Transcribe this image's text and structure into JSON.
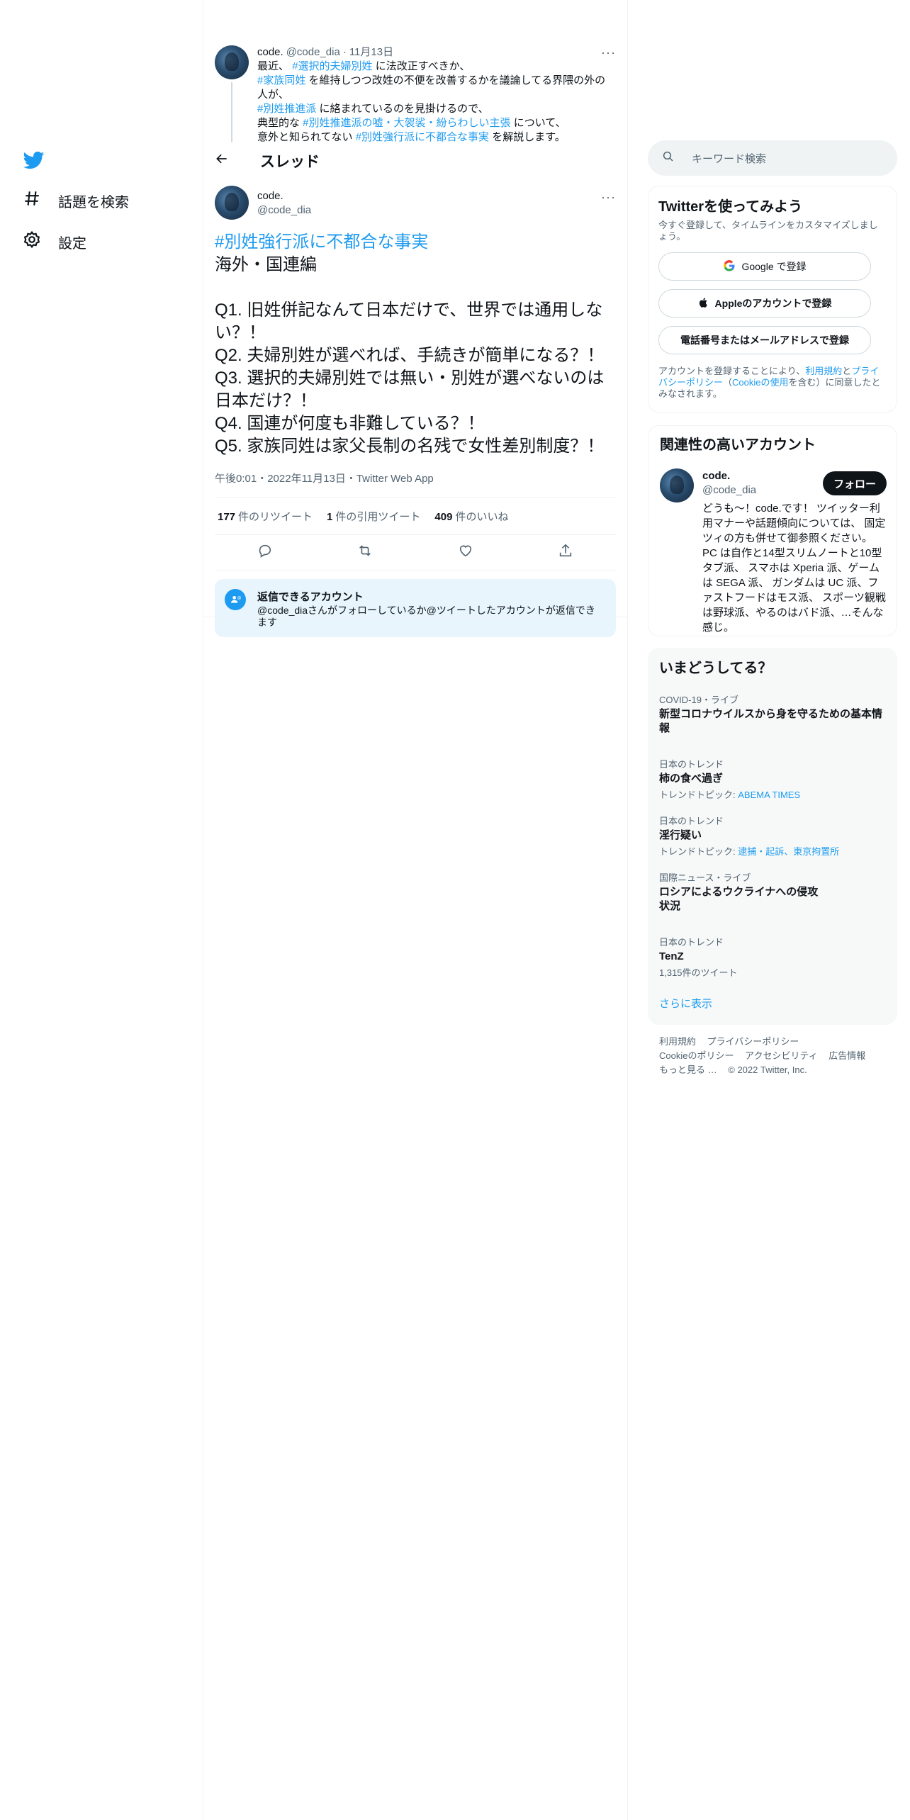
{
  "nav": {
    "items": [
      {
        "label": "話題を検索",
        "icon": "hashtag-icon"
      },
      {
        "label": "設定",
        "icon": "gear-icon"
      }
    ]
  },
  "parent_tweet": {
    "name": "code.",
    "handle": "@code_dia",
    "date": "11月13日",
    "line1_pre": "最近、",
    "line1_tag": "#選択的夫婦別姓",
    "line1_post": " に法改正すべきか、",
    "line2_tag": "#家族同姓",
    "line2_post": " を維持しつつ改姓の不便を改善するかを議論してる界隈の外の人が、",
    "line3_tag": "#別姓推進派",
    "line3_post": " に絡まれているのを見掛けるので、",
    "line4_pre": "典型的な ",
    "line4_tag": "#別姓推進派の嘘・大袈裟・紛らわしい主張",
    "line4_post": " について、",
    "line5_pre": "意外と知られてない ",
    "line5_tag": "#別姓強行派に不都合な事実",
    "line5_post": " を解説します。"
  },
  "thread_header": {
    "title": "スレッド"
  },
  "tweet": {
    "name": "code.",
    "handle": "@code_dia",
    "hashtag": "#別姓強行派に不都合な事実",
    "body": "海外・国連編\n\nQ1. 旧姓併記なんて日本だけで、世界では通用しない？！\nQ2. 夫婦別姓が選べれば、手続きが簡単になる？！\nQ3. 選択的夫婦別姓では無い・別姓が選べないのは日本だけ？！\nQ4. 国連が何度も非難している？！\nQ5. 家族同姓は家父長制の名残で女性差別制度？！",
    "meta": "午後0:01・2022年11月13日・Twitter Web App",
    "retweets_count": "177",
    "retweets_label": "件のリツイート",
    "quotes_count": "1",
    "quotes_label": "件の引用ツイート",
    "likes_count": "409",
    "likes_label": "件のいいね"
  },
  "reply_box": {
    "title": "返信できるアカウント",
    "text": "@code_diaさんがフォローしているか@ツイートしたアカウントが返信できます"
  },
  "search": {
    "placeholder": "キーワード検索"
  },
  "signup": {
    "title": "Twitterを使ってみよう",
    "subtitle": "今すぐ登録して、タイムラインをカスタマイズしましょう。",
    "google_label": "Google で登録",
    "apple_label": "Appleのアカウントで登録",
    "phone_label": "電話番号またはメールアドレスで登録",
    "legal_pre": "アカウントを登録することにより、",
    "legal_terms": "利用規約",
    "legal_and": "と",
    "legal_privacy": "プライバシーポリシー",
    "legal_mid": "（",
    "legal_cookie": "Cookieの使用",
    "legal_post": "を含む）に同意したとみなされます。"
  },
  "related": {
    "title": "関連性の高いアカウント",
    "name": "code.",
    "handle": "@code_dia",
    "follow_label": "フォロー",
    "bio": "どうも～！code.です！ ツイッター利用マナーや話題傾向については、 固定ツィの方も併せて御参照ください。　PC は自作と14型スリムノートと10型タブ派、 スマホは Xperia 派、ゲームは SEGA 派、 ガンダムは UC 派、ファストフードはモス派、 スポーツ観戦は野球派、やるのはバド派、…そんな感じ。"
  },
  "trends": {
    "title": "いまどうしてる？",
    "items": [
      {
        "context": "COVID-19・ライブ",
        "title": "新型コロナウイルスから身を守るための基本情報",
        "sub_label": "",
        "sub_link": ""
      },
      {
        "context": "日本のトレンド",
        "title": "柿の食べ過ぎ",
        "sub_label": "トレンドトピック: ",
        "sub_link": "ABEMA TIMES"
      },
      {
        "context": "日本のトレンド",
        "title": "淫行疑い",
        "sub_label": "トレンドトピック: ",
        "sub_link": "逮捕・起訴、東京拘置所"
      },
      {
        "context": "国際ニュース・ライブ",
        "title": "ロシアによるウクライナへの侵攻状況",
        "sub_label": "",
        "sub_link": ""
      },
      {
        "context": "日本のトレンド",
        "title": "TenZ",
        "sub_label": "1,315件のツイート",
        "sub_link": ""
      }
    ],
    "show_more": "さらに表示"
  },
  "footer": {
    "terms": "利用規約",
    "privacy": "プライバシーポリシー",
    "cookie": "Cookieのポリシー",
    "accessibility": "アクセシビリティ",
    "ads": "広告情報",
    "more": "もっと見る …",
    "copyright": "© 2022 Twitter, Inc."
  },
  "colors": {
    "accent": "#1d9bf0",
    "text": "#0f1419",
    "secondary": "#536471"
  }
}
